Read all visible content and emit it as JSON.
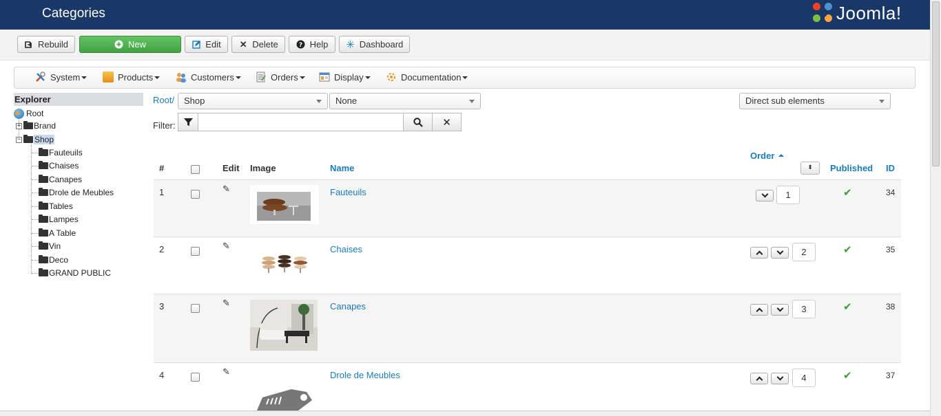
{
  "header": {
    "title": "Categories",
    "logo_text": "Joomla!"
  },
  "toolbar": {
    "rebuild": "Rebuild",
    "new": "New",
    "edit": "Edit",
    "delete": "Delete",
    "help": "Help",
    "dashboard": "Dashboard"
  },
  "menu": {
    "system": "System",
    "products": "Products",
    "customers": "Customers",
    "orders": "Orders",
    "display": "Display",
    "documentation": "Documentation"
  },
  "explorer": {
    "title": "Explorer",
    "root": "Root",
    "brand": "Brand",
    "shop": "Shop",
    "children": [
      "Fauteuils",
      "Chaises",
      "Canapes",
      "Drole de Meubles",
      "Tables",
      "Lampes",
      "A Table",
      "Vin",
      "Deco",
      "GRAND PUBLIC"
    ]
  },
  "filters": {
    "root_link": "Root/",
    "shop_select": "Shop",
    "none_select": "None",
    "scope_select": "Direct sub elements",
    "filter_label": "Filter:",
    "filter_value": ""
  },
  "table": {
    "headers": {
      "num": "#",
      "edit": "Edit",
      "image": "Image",
      "name": "Name",
      "order": "Order",
      "published": "Published",
      "id": "ID"
    },
    "rows": [
      {
        "num": "1",
        "name": "Fauteuils",
        "order": "1",
        "id": "34",
        "published": true
      },
      {
        "num": "2",
        "name": "Chaises",
        "order": "2",
        "id": "35",
        "published": true
      },
      {
        "num": "3",
        "name": "Canapes",
        "order": "3",
        "id": "38",
        "published": true
      },
      {
        "num": "4",
        "name": "Drole de Meubles",
        "order": "4",
        "id": "37",
        "published": true
      }
    ]
  },
  "colors": {
    "header_bg": "#1a3867",
    "link": "#1a7bb9",
    "new_button": "#4cae4c",
    "published_check": "#3c9a3c"
  },
  "icons": {
    "rebuild": "rebuild-icon",
    "new": "plus-circle-icon",
    "edit": "edit-icon",
    "delete": "close-icon",
    "help": "help-icon",
    "dashboard": "dashboard-icon",
    "filter": "filter-icon",
    "search": "search-icon",
    "clear": "close-icon"
  }
}
